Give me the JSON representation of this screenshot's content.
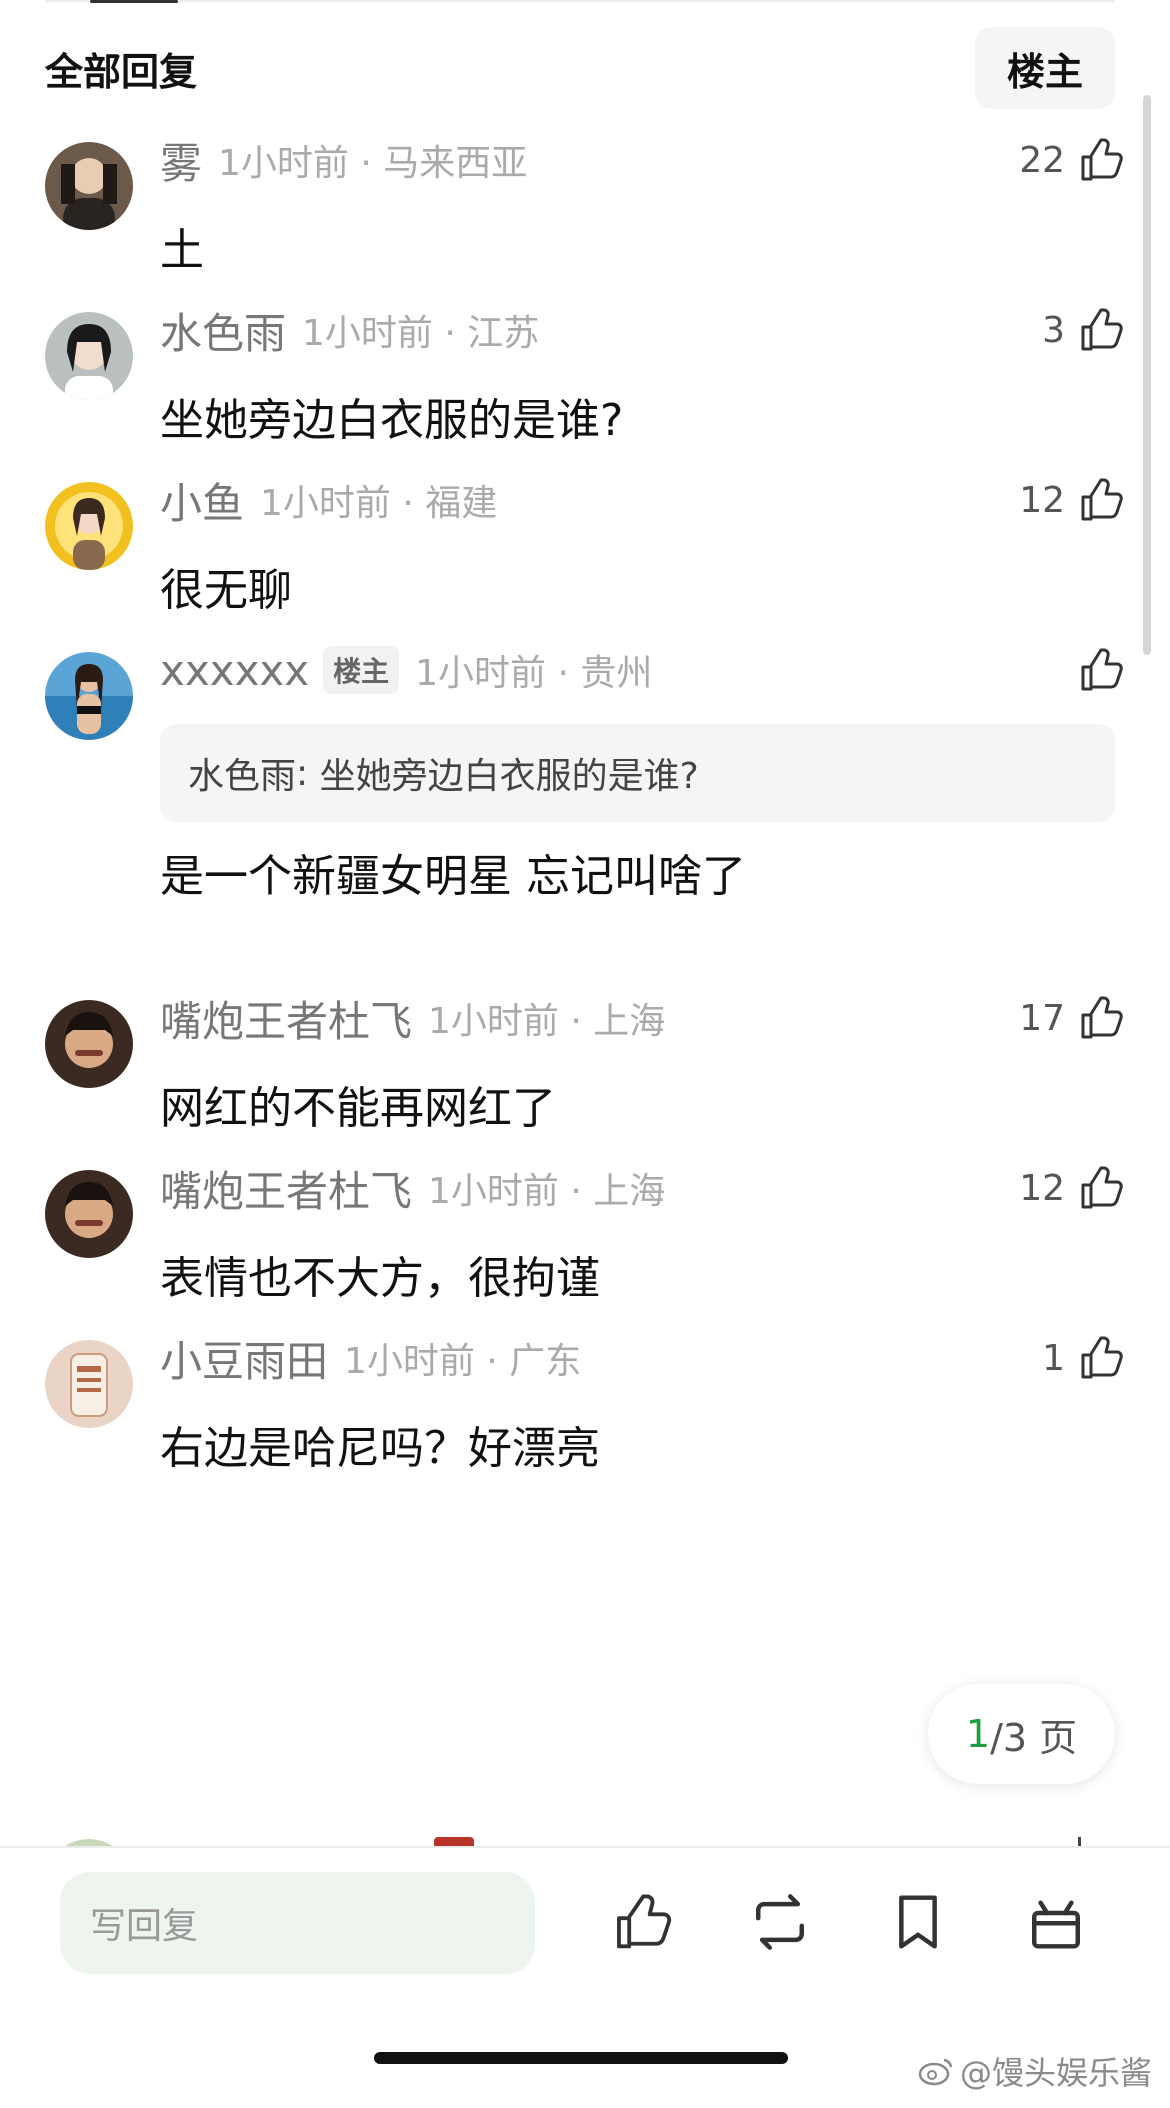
{
  "header": {
    "title": "全部回复",
    "filter_owner": "楼主"
  },
  "comments": [
    {
      "user": "雾",
      "time": "1小时前",
      "location": "马来西亚",
      "text": "土",
      "likes": "22"
    },
    {
      "user": "水色雨",
      "time": "1小时前",
      "location": "江苏",
      "text": "坐她旁边白衣服的是谁?",
      "likes": "3"
    },
    {
      "user": "小鱼",
      "time": "1小时前",
      "location": "福建",
      "text": "很无聊",
      "likes": "12"
    },
    {
      "user": "xxxxxx",
      "badge": "楼主",
      "time": "1小时前",
      "location": "贵州",
      "text": "是一个新疆女明星 忘记叫啥了",
      "likes": "",
      "quote": {
        "name": "水色雨",
        "sep": ":",
        "text": "坐她旁边白衣服的是谁?"
      }
    },
    {
      "user": "嘴炮王者杜飞",
      "time": "1小时前",
      "location": "上海",
      "text": "网红的不能再网红了",
      "likes": "17"
    },
    {
      "user": "嘴炮王者杜飞",
      "time": "1小时前",
      "location": "上海",
      "text": "表情也不大方，很拘谨",
      "likes": "12"
    },
    {
      "user": "小豆雨田",
      "time": "1小时前",
      "location": "广东",
      "text": "右边是哈尼吗？好漂亮",
      "likes": "1"
    }
  ],
  "meta_separator": "·",
  "pagination": {
    "current": "1",
    "total": "/3 页"
  },
  "bottom_bar": {
    "reply_placeholder": "写回复",
    "icons": [
      "thumbs-up-icon",
      "repost-icon",
      "bookmark-icon",
      "gift-icon"
    ]
  },
  "watermark": "@馒头娱乐酱",
  "colors": {
    "accent_green": "#1e9e3e",
    "input_bg": "#eef4ee"
  }
}
